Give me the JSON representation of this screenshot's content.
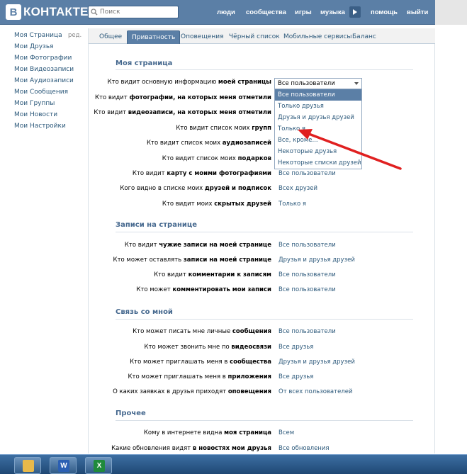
{
  "header": {
    "logo_letter": "В",
    "logo_text": "КОНТАКТЕ",
    "search_placeholder": "Поиск",
    "nav": [
      "люди",
      "сообщества",
      "игры",
      "музыка",
      "помощь",
      "выйти"
    ]
  },
  "sidebar": {
    "items": [
      "Моя Страница",
      "Мои Друзья",
      "Мои Фотографии",
      "Мои Видеозаписи",
      "Мои Аудиозаписи",
      "Мои Сообщения",
      "Мои Группы",
      "Мои Новости",
      "Мои Настройки"
    ],
    "edit_label": "ред."
  },
  "tabs": [
    "Общее",
    "Приватность",
    "Оповещения",
    "Чёрный список",
    "Мобильные сервисы",
    "Баланс"
  ],
  "active_tab": "Приватность",
  "sections": [
    {
      "title": "Моя страница",
      "rows": [
        {
          "pre": "Кто видит основную информацию ",
          "bold": "моей страницы",
          "post": "",
          "value": "Все пользователи"
        },
        {
          "pre": "Кто видит ",
          "bold": "фотографии, на которых меня отметили",
          "post": "",
          "value": ""
        },
        {
          "pre": "Кто видит ",
          "bold": "видеозаписи, на которых меня отметили",
          "post": "",
          "value": ""
        },
        {
          "pre": "Кто видит список моих ",
          "bold": "групп",
          "post": "",
          "value": ""
        },
        {
          "pre": "Кто видит список моих ",
          "bold": "аудиозаписей",
          "post": "",
          "value": ""
        },
        {
          "pre": "Кто видит список моих ",
          "bold": "подарков",
          "post": "",
          "value": ""
        },
        {
          "pre": "Кто видит ",
          "bold": "карту с моими фотографиями",
          "post": "",
          "value": "Все пользователи"
        },
        {
          "pre": "Кого видно в списке моих ",
          "bold": "друзей и подписок",
          "post": "",
          "value": "Всех друзей"
        },
        {
          "pre": "Кто видит моих ",
          "bold": "скрытых друзей",
          "post": "",
          "value": "Только я"
        }
      ]
    },
    {
      "title": "Записи на странице",
      "rows": [
        {
          "pre": "Кто видит ",
          "bold": "чужие записи на моей странице",
          "post": "",
          "value": "Все пользователи"
        },
        {
          "pre": "Кто может оставлять ",
          "bold": "записи на моей странице",
          "post": "",
          "value": "Друзья и друзья друзей"
        },
        {
          "pre": "Кто видит ",
          "bold": "комментарии к записям",
          "post": "",
          "value": "Все пользователи"
        },
        {
          "pre": "Кто может ",
          "bold": "комментировать мои записи",
          "post": "",
          "value": "Все пользователи"
        }
      ]
    },
    {
      "title": "Связь со мной",
      "rows": [
        {
          "pre": "Кто может писать мне личные ",
          "bold": "сообщения",
          "post": "",
          "value": "Все пользователи"
        },
        {
          "pre": "Кто может звонить мне по ",
          "bold": "видеосвязи",
          "post": "",
          "value": "Все друзья"
        },
        {
          "pre": "Кто может приглашать меня в ",
          "bold": "сообщества",
          "post": "",
          "value": "Друзья и друзья друзей"
        },
        {
          "pre": "Кто может приглашать меня в ",
          "bold": "приложения",
          "post": "",
          "value": "Все друзья"
        },
        {
          "pre": "О каких заявках в друзья приходят ",
          "bold": "оповещения",
          "post": "",
          "value": "От всех пользователей"
        }
      ]
    },
    {
      "title": "Прочее",
      "rows": [
        {
          "pre": "Кому в интернете видна ",
          "bold": "моя страница",
          "post": "",
          "value": "Всем"
        },
        {
          "pre": "Какие обновления видят ",
          "bold": "в новостях мои друзья",
          "post": "",
          "value": "Все обновления"
        }
      ]
    }
  ],
  "dropdown": {
    "selected": "Все пользователи",
    "options": [
      "Все пользователи",
      "Только друзья",
      "Друзья и друзья друзей",
      "Только я",
      "Все, кроме...",
      "Некоторые друзья",
      "Некоторые списки друзей"
    ],
    "highlighted": "Все пользователи"
  },
  "annotation": {
    "color": "#e02020"
  },
  "taskbar": {
    "apps": [
      "outlook-icon",
      "word-icon",
      "excel-icon"
    ]
  }
}
